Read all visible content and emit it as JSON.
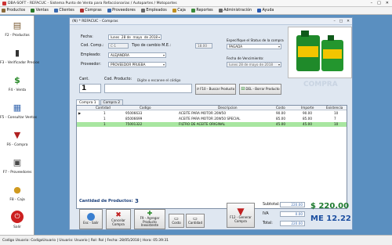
{
  "window": {
    "title": "DBA-SOFT - REFACUC - Sistema Punto de Venta para Refaccionarias / Autopartes / Motopartes",
    "controls": [
      "–",
      "□",
      "✕"
    ]
  },
  "menu": [
    {
      "label": "Productos",
      "icon": "box-icon",
      "color": "#8a6a3a"
    },
    {
      "label": "Ventas",
      "icon": "cart-icon",
      "color": "#2a7a2a"
    },
    {
      "label": "Clientes",
      "icon": "users-icon",
      "color": "#3a6ab0"
    },
    {
      "label": "Compras",
      "icon": "cart-icon",
      "color": "#b03030"
    },
    {
      "label": "Proveedores",
      "icon": "truck-icon",
      "color": "#3a6ab0"
    },
    {
      "label": "Empleados",
      "icon": "user-icon",
      "color": "#6a6a6a"
    },
    {
      "label": "Caja",
      "icon": "register-icon",
      "color": "#c09020"
    },
    {
      "label": "Reportes",
      "icon": "report-icon",
      "color": "#3a8a3a"
    },
    {
      "label": "Administración",
      "icon": "gear-icon",
      "color": "#666"
    },
    {
      "label": "Ayuda",
      "icon": "help-icon",
      "color": "#2a5ab0"
    }
  ],
  "sidebar": [
    {
      "label": "F2 - Productos",
      "icon": "box-icon",
      "glyph": "▤",
      "color": "#7a5a30"
    },
    {
      "label": "F3 - Verificador Precios",
      "icon": "barcode-scanner-icon",
      "glyph": "▮",
      "color": "#333"
    },
    {
      "label": "F4 - Venta",
      "icon": "money-icon",
      "glyph": "$",
      "color": "#2a8a2a"
    },
    {
      "label": "F5 - Consultar Ventas",
      "icon": "chart-icon",
      "glyph": "▦",
      "color": "#3a6ab0"
    },
    {
      "label": "F6 - Compra",
      "icon": "basket-icon",
      "glyph": "▼",
      "color": "#b02020"
    },
    {
      "label": "F7 - Proveedores",
      "icon": "supplier-icon",
      "glyph": "▣",
      "color": "#4a4a4a"
    },
    {
      "label": "F8 - Caja",
      "icon": "coins-icon",
      "glyph": "●",
      "color": "#d09a20"
    },
    {
      "label": "Salir",
      "icon": "power-icon",
      "glyph": "⏻",
      "color": "#ffffff"
    }
  ],
  "compras": {
    "window_title": "(N) * REFACUC  -  Compras",
    "fecha_label": "Fecha:",
    "fecha_dia": "lunes",
    "fecha_num": "28 de",
    "fecha_mes": "mayo",
    "fecha_anio": "de 2018",
    "cod_comp_label": "Cod. Comp.:",
    "cod_comp_value": "C-1",
    "tipo_cambio_label": "Tipo de cambio M.E.:",
    "tipo_cambio_value": "18.00",
    "empleado_label": "Empleado:",
    "empleado_value": "ALEJANDRA",
    "proveedor_label": "Proveedor:",
    "proveedor_value": "PROVEEDOR PRUEBA",
    "status_label": "Especifique el Status de la compra",
    "status_value": "PAGADA",
    "venc_label": "Fecha de Vencimiento:",
    "venc_value": "lunes   28 de   mayo   de 2018",
    "cant_label": "Cant.",
    "cant_value": "1",
    "cod_prod_label": "Cod. Producto:",
    "cod_prod_hint": "Digite o escanee el código",
    "buscar_btn": "F10 - Buscar Producto",
    "borrar_btn": "DEL - Borrar Producto",
    "watermark": "COMPRA",
    "tabs": [
      "Compra 1",
      "Compra 2"
    ],
    "columns": [
      "Cantidad",
      "Codigo",
      "Descripcion",
      "Costo",
      "Importe",
      "Existencia"
    ],
    "rows": [
      {
        "marker": "▶",
        "cantidad": "1",
        "codigo": "95006633",
        "descripcion": "ACEITE PARA MOTOR 20W50",
        "costo": "90.00",
        "importe": "90.00",
        "existencia": "10",
        "bg": "#ffffff"
      },
      {
        "marker": "",
        "cantidad": "1",
        "codigo": "85006699",
        "descripcion": "ACEITE PARA MOTOR 20W50 SPECIAL",
        "costo": "85.00",
        "importe": "85.00",
        "existencia": "7",
        "bg": "#ffffff"
      },
      {
        "marker": "",
        "cantidad": "1",
        "codigo": "75001322",
        "descripcion": "FILTRO DE ACEITE ORIGINAL",
        "costo": "45.00",
        "importe": "45.00",
        "existencia": "10",
        "bg": "#a8e6a0"
      }
    ],
    "cantidad_productos_label": "Cantidad de Productos:",
    "cantidad_productos_value": "3",
    "subtotal_label": "Subtotal:",
    "subtotal_value": "220.00",
    "iva_label": "IVA",
    "iva_value": "0.00",
    "total_label": "Total:",
    "total_value": "220.00",
    "total_big": "$ 220.00",
    "total_me": "ME 12.22",
    "actions": [
      {
        "label": "Esc - Salir",
        "icon": "exit-icon"
      },
      {
        "label": "Cancelar Compra",
        "icon": "cancel-icon"
      },
      {
        "label": "F9 - Agregar Producto Inexistente",
        "icon": "add-product-icon"
      },
      {
        "label": "Costo",
        "icon": "cost-icon"
      },
      {
        "label": "Cantidad",
        "icon": "quantity-icon"
      },
      {
        "label": "F12 - Generar Compra",
        "icon": "generate-purchase-icon"
      }
    ]
  },
  "status_bar": {
    "text": "Codigo Usuario:  CodigoUsuario   |   Usuario:  Usuario   |   Rol:  Rol   |   Fecha:  28/05/2018   |   Hora:  05:39:31"
  }
}
